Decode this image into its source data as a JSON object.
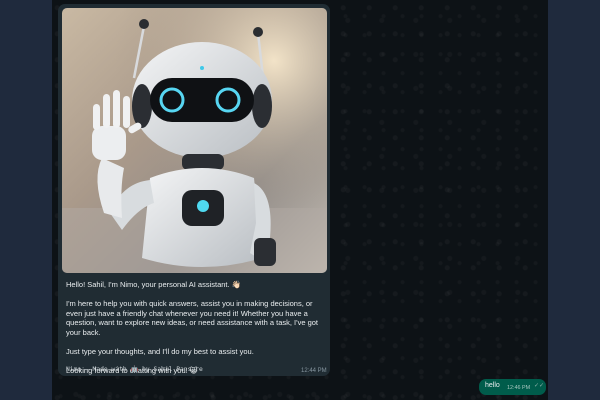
{
  "messages": {
    "incoming": {
      "greeting": "Hello! Sahil, I'm Nimo, your personal AI assistant. 👋🏻",
      "paragraph": "I'm here to help you with quick answers, assist you in making decisions, or even just have a friendly chat whenever you need it! Whether you have a question, want to explore new ideas, or need assistance with a task, I've got your back.",
      "instruction": "Just type your thoughts, and I'll do my best to assist you.",
      "closing": "Looking forward to chatting with you! 😺",
      "signature": "Nimo – Made with 🤖 by Sahil Pansare",
      "time": "12:44 PM",
      "image_icon": "robot-waving-image"
    },
    "outgoing": {
      "text": "hello",
      "time": "12:46 PM",
      "status_icon": "double-check-icon"
    }
  },
  "colors": {
    "chat_background": "#0d1216",
    "incoming_bubble": "#202c33",
    "outgoing_bubble": "#005c4b",
    "side_panel": "#1f2a3d"
  }
}
